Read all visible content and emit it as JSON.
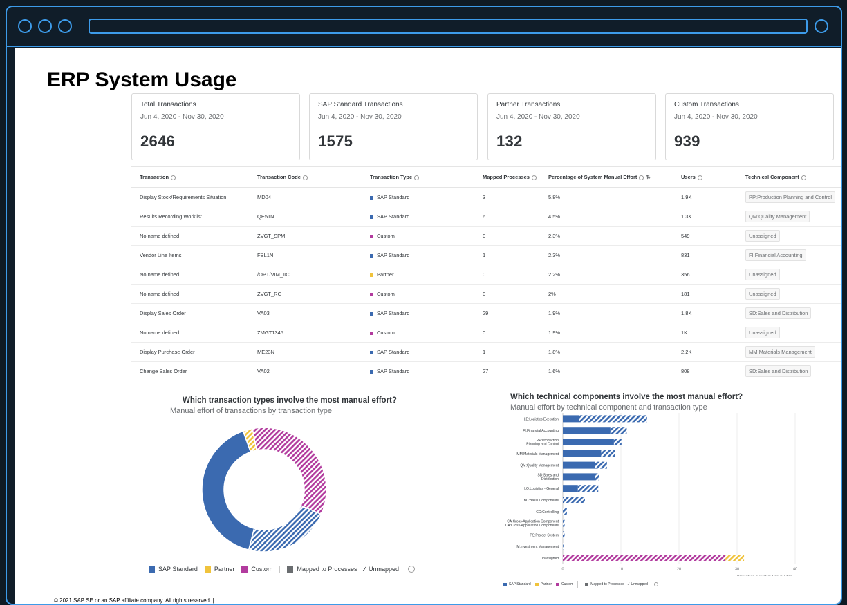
{
  "page": {
    "title": "ERP System Usage",
    "footer": "© 2021 SAP SE or an SAP affiliate company. All rights reserved.  |"
  },
  "kpis": [
    {
      "label": "Total Transactions",
      "date": "Jun 4, 2020 - Nov 30, 2020",
      "value": "2646"
    },
    {
      "label": "SAP Standard Transactions",
      "date": "Jun 4, 2020 - Nov 30, 2020",
      "value": "1575"
    },
    {
      "label": "Partner Transactions",
      "date": "Jun 4, 2020 - Nov 30, 2020",
      "value": "132"
    },
    {
      "label": "Custom Transactions",
      "date": "Jun 4, 2020 - Nov 30, 2020",
      "value": "939"
    }
  ],
  "table": {
    "headers": [
      "Transaction",
      "Transaction Code",
      "Transaction Type",
      "Mapped Processes",
      "Percentage of System Manual Effort",
      "Users",
      "Technical Component"
    ],
    "rows": [
      [
        "Display Stock/Requirements Situation",
        "MD04",
        "SAP Standard",
        "3",
        "5.8%",
        "1.9K",
        "PP:Production Planning and Control"
      ],
      [
        "Results Recording Worklist",
        "QE51N",
        "SAP Standard",
        "6",
        "4.5%",
        "1.3K",
        "QM:Quality Management"
      ],
      [
        "No name defined",
        "ZVGT_SPM",
        "Custom",
        "0",
        "2.3%",
        "549",
        "Unassigned"
      ],
      [
        "Vendor Line Items",
        "FBL1N",
        "SAP Standard",
        "1",
        "2.3%",
        "831",
        "FI:Financial Accounting"
      ],
      [
        "No name defined",
        "/OPT/VIM_IIC",
        "Partner",
        "0",
        "2.2%",
        "356",
        "Unassigned"
      ],
      [
        "No name defined",
        "ZVGT_RC",
        "Custom",
        "0",
        "2%",
        "181",
        "Unassigned"
      ],
      [
        "Display Sales Order",
        "VA03",
        "SAP Standard",
        "29",
        "1.9%",
        "1.8K",
        "SD:Sales and Distribution"
      ],
      [
        "No name defined",
        "ZMGT1345",
        "Custom",
        "0",
        "1.9%",
        "1K",
        "Unassigned"
      ],
      [
        "Display Purchase Order",
        "ME23N",
        "SAP Standard",
        "1",
        "1.8%",
        "2.2K",
        "MM:Materials Management"
      ],
      [
        "Change Sales Order",
        "VA02",
        "SAP Standard",
        "27",
        "1.6%",
        "808",
        "SD:Sales and Distribution"
      ]
    ],
    "type_colors": {
      "SAP Standard": "#3b6ab0",
      "Partner": "#f0c33c",
      "Custom": "#b23b9e"
    }
  },
  "donut": {
    "title": "Which transaction types involve the most manual effort?",
    "subtitle": "Manual effort of transactions by transaction type"
  },
  "bars": {
    "title": "Which technical components involve the most manual effort?",
    "subtitle": "Manual effort by technical component and transaction type",
    "axis_title": "Percentage of System Manual Effort",
    "ticks": [
      "0",
      "10",
      "20",
      "30",
      "40"
    ]
  },
  "legend": {
    "sap": "SAP Standard",
    "partner": "Partner",
    "custom": "Custom",
    "mapped": "Mapped to Processes",
    "unmapped": "Unmapped"
  },
  "colors": {
    "sap": "#3b6ab0",
    "partner": "#f0c33c",
    "custom": "#b23b9e",
    "mapped": "#6a6d70",
    "accent": "#3d9be9"
  },
  "chart_data": [
    {
      "type": "pie",
      "title": "Which transaction types involve the most manual effort?",
      "subtitle": "Manual effort of transactions by transaction type",
      "slices": [
        {
          "name": "SAP Standard",
          "status": "Mapped to Processes",
          "value": 40.5
        },
        {
          "name": "SAP Standard",
          "status": "Unmapped",
          "value": 22.5
        },
        {
          "name": "Custom",
          "status": "Unmapped",
          "value": 34.5
        },
        {
          "name": "Partner",
          "status": "Unmapped",
          "value": 2.5
        }
      ],
      "legend_position": "bottom"
    },
    {
      "type": "bar",
      "orientation": "horizontal",
      "title": "Which technical components involve the most manual effort?",
      "subtitle": "Manual effort by technical component and transaction type",
      "xlabel": "Percentage of System Manual Effort",
      "xlim": [
        0,
        40
      ],
      "categories": [
        "LE:Logistics Execution",
        "FI:Financial Accounting",
        "PP:Production Planning and Control",
        "MM:Materials Management",
        "QM:Quality Management",
        "SD:Sales and Distribution",
        "LO:Logistics - General",
        "BC:Basis Components",
        "CO:Controlling",
        "CA:Cross-Application Components",
        "PS:Project System",
        "IM:Investment Management",
        "Unassigned"
      ],
      "series": [
        {
          "name": "SAP Standard",
          "status": "Mapped to Processes",
          "values": [
            2.8,
            8.2,
            8.8,
            6.6,
            5.5,
            5.6,
            2.6,
            0,
            0,
            0,
            0,
            0,
            0
          ]
        },
        {
          "name": "SAP Standard",
          "status": "Unmapped",
          "values": [
            11.7,
            2.8,
            1.3,
            2.4,
            2.1,
            0.7,
            3.5,
            3.8,
            0.7,
            0.3,
            0.3,
            0.1,
            0
          ]
        },
        {
          "name": "Custom",
          "status": "Unmapped",
          "values": [
            0,
            0,
            0,
            0,
            0,
            0,
            0,
            0,
            0,
            0,
            0,
            0,
            28.0
          ]
        },
        {
          "name": "Partner",
          "status": "Unmapped",
          "values": [
            0,
            0,
            0,
            0,
            0,
            0,
            0,
            0,
            0,
            0,
            0,
            0,
            3.2
          ]
        }
      ],
      "grid": true,
      "legend_position": "bottom"
    }
  ]
}
